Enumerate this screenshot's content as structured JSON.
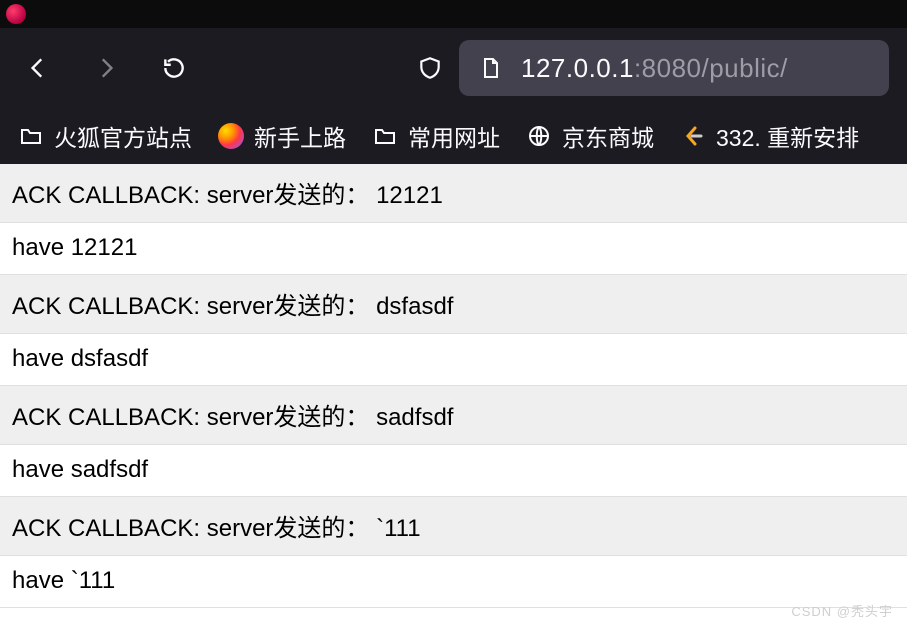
{
  "url": {
    "host": "127.0.0.1",
    "port_path": ":8080/public/"
  },
  "bookmarks": [
    {
      "label": "火狐官方站点",
      "icon": "folder"
    },
    {
      "label": "新手上路",
      "icon": "firefox"
    },
    {
      "label": "常用网址",
      "icon": "folder"
    },
    {
      "label": "京东商城",
      "icon": "globe"
    },
    {
      "label": "332. 重新安排",
      "icon": "leetcode"
    }
  ],
  "content_rows": [
    "ACK CALLBACK: server发送的： 12121",
    "have 12121",
    "ACK CALLBACK: server发送的： dsfasdf",
    "have dsfasdf",
    "ACK CALLBACK: server发送的： sadfsdf",
    "have sadfsdf",
    "ACK CALLBACK: server发送的： `111",
    "have `111"
  ],
  "watermark": "CSDN @秃头宇"
}
